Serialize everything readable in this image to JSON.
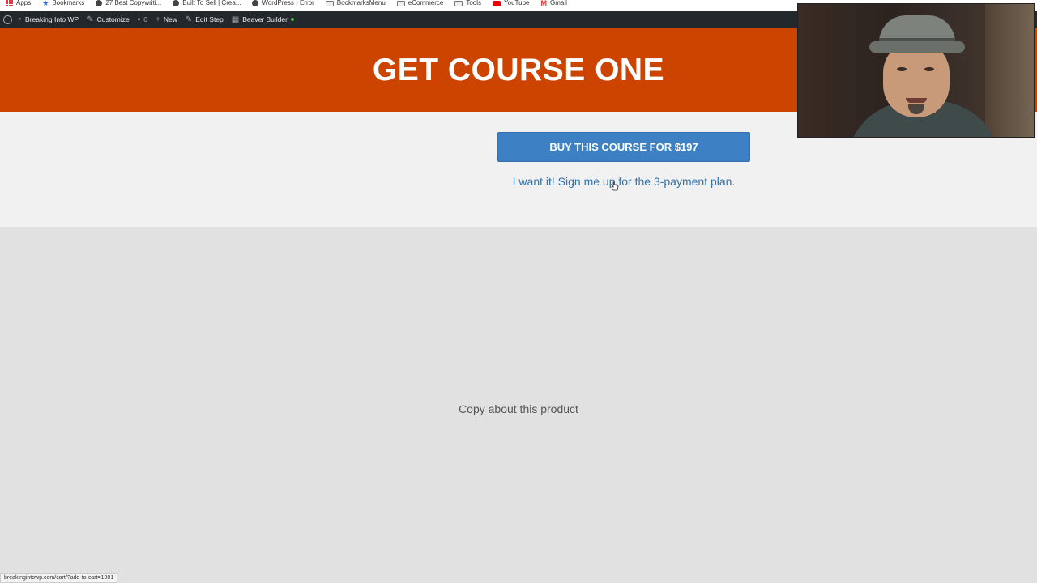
{
  "bookmarks": [
    {
      "label": "Apps",
      "icon": "apps-grid-icon"
    },
    {
      "label": "Bookmarks",
      "icon": "star-icon"
    },
    {
      "label": "27 Best Copywriti...",
      "icon": "globe-icon"
    },
    {
      "label": "Built To Sell | Crea...",
      "icon": "hat-icon"
    },
    {
      "label": "WordPress › Error",
      "icon": "globe-icon"
    },
    {
      "label": "BookmarksMenu",
      "icon": "folder-icon"
    },
    {
      "label": "eCommerce",
      "icon": "folder-icon"
    },
    {
      "label": "Tools",
      "icon": "folder-icon"
    },
    {
      "label": "YouTube",
      "icon": "youtube-icon"
    },
    {
      "label": "Gmail",
      "icon": "gmail-icon"
    }
  ],
  "admin_bar": {
    "site_name": "Breaking Into WP",
    "customize": "Customize",
    "comments_count": "0",
    "new": "New",
    "edit_step": "Edit Step",
    "beaver_builder": "Beaver Builder"
  },
  "hero": {
    "title": "GET COURSE ONE",
    "bg_color": "#cc4400"
  },
  "buy": {
    "button_label": "BUY THIS COURSE FOR $197",
    "payment_link": "I want it! Sign me up for the 3-payment plan.",
    "button_color": "#3d80c3"
  },
  "copy": {
    "text": "Copy about this product"
  },
  "status_bar": {
    "url": "breakingintowp.com/cart/?add-to-cart=1901"
  }
}
